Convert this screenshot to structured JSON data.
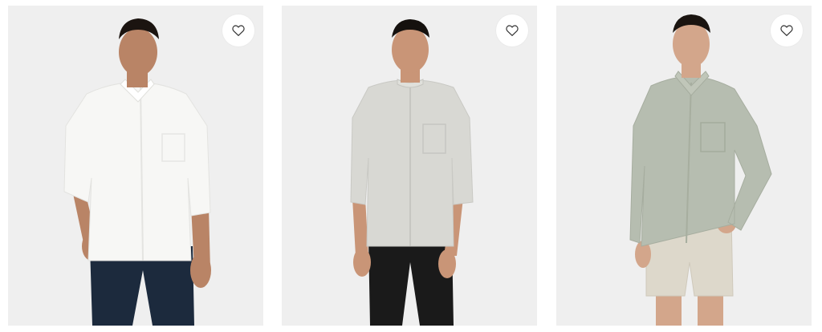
{
  "products": [
    {
      "name_icon": "heart-icon",
      "shirt_color": "#f7f7f5",
      "pants_color": "#1c2a3d",
      "skin_color": "#b98466",
      "hair_color": "#1b1410",
      "style": "long-pants"
    },
    {
      "name_icon": "heart-icon",
      "shirt_color": "#d8d8d3",
      "pants_color": "#1a1a1a",
      "skin_color": "#c99577",
      "hair_color": "#15110e",
      "style": "long-pants"
    },
    {
      "name_icon": "heart-icon",
      "shirt_color": "#b6bdb0",
      "pants_color": "#ddd8cb",
      "skin_color": "#d3a68b",
      "hair_color": "#1a1410",
      "style": "shorts"
    }
  ]
}
